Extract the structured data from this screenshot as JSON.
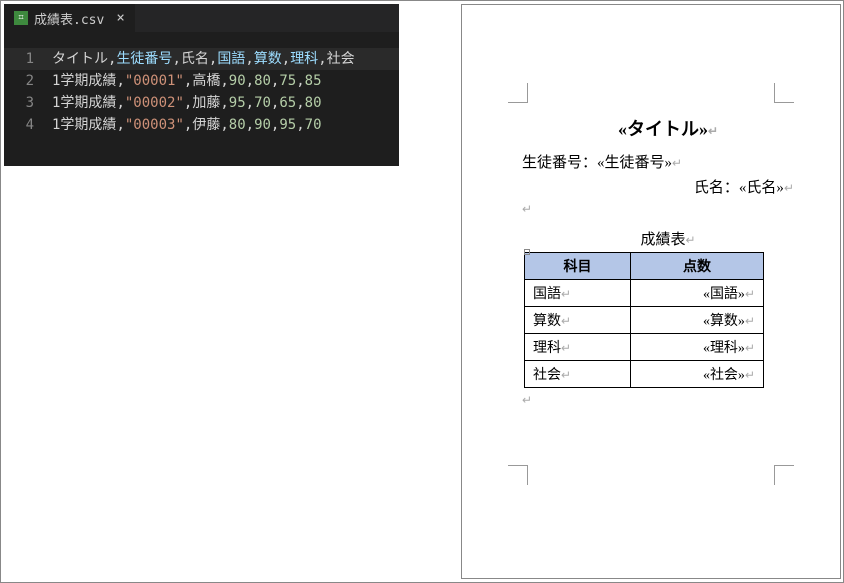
{
  "editor": {
    "filename": "成績表.csv",
    "lines": [
      {
        "n": "1",
        "tokens": [
          {
            "t": "タイトル",
            "c": "tok-plain"
          },
          {
            "t": ",",
            "c": "tok-plain"
          },
          {
            "t": "生徒番号",
            "c": "tok-field"
          },
          {
            "t": ",",
            "c": "tok-plain"
          },
          {
            "t": "氏名",
            "c": "tok-plain"
          },
          {
            "t": ",",
            "c": "tok-plain"
          },
          {
            "t": "国語",
            "c": "tok-field"
          },
          {
            "t": ",",
            "c": "tok-plain"
          },
          {
            "t": "算数",
            "c": "tok-field"
          },
          {
            "t": ",",
            "c": "tok-plain"
          },
          {
            "t": "理科",
            "c": "tok-field"
          },
          {
            "t": ",",
            "c": "tok-plain"
          },
          {
            "t": "社会",
            "c": "tok-plain"
          }
        ]
      },
      {
        "n": "2",
        "tokens": [
          {
            "t": "1学期成績",
            "c": "tok-plain"
          },
          {
            "t": ",",
            "c": "tok-plain"
          },
          {
            "t": "\"00001\"",
            "c": "tok-string"
          },
          {
            "t": ",",
            "c": "tok-plain"
          },
          {
            "t": "高橋",
            "c": "tok-plain"
          },
          {
            "t": ",",
            "c": "tok-plain"
          },
          {
            "t": "90",
            "c": "tok-number"
          },
          {
            "t": ",",
            "c": "tok-plain"
          },
          {
            "t": "80",
            "c": "tok-number"
          },
          {
            "t": ",",
            "c": "tok-plain"
          },
          {
            "t": "75",
            "c": "tok-number"
          },
          {
            "t": ",",
            "c": "tok-plain"
          },
          {
            "t": "85",
            "c": "tok-number"
          }
        ]
      },
      {
        "n": "3",
        "tokens": [
          {
            "t": "1学期成績",
            "c": "tok-plain"
          },
          {
            "t": ",",
            "c": "tok-plain"
          },
          {
            "t": "\"00002\"",
            "c": "tok-string"
          },
          {
            "t": ",",
            "c": "tok-plain"
          },
          {
            "t": "加藤",
            "c": "tok-plain"
          },
          {
            "t": ",",
            "c": "tok-plain"
          },
          {
            "t": "95",
            "c": "tok-number"
          },
          {
            "t": ",",
            "c": "tok-plain"
          },
          {
            "t": "70",
            "c": "tok-number"
          },
          {
            "t": ",",
            "c": "tok-plain"
          },
          {
            "t": "65",
            "c": "tok-number"
          },
          {
            "t": ",",
            "c": "tok-plain"
          },
          {
            "t": "80",
            "c": "tok-number"
          }
        ]
      },
      {
        "n": "4",
        "tokens": [
          {
            "t": "1学期成績",
            "c": "tok-plain"
          },
          {
            "t": ",",
            "c": "tok-plain"
          },
          {
            "t": "\"00003\"",
            "c": "tok-string"
          },
          {
            "t": ",",
            "c": "tok-plain"
          },
          {
            "t": "伊藤",
            "c": "tok-plain"
          },
          {
            "t": ",",
            "c": "tok-plain"
          },
          {
            "t": "80",
            "c": "tok-number"
          },
          {
            "t": ",",
            "c": "tok-plain"
          },
          {
            "t": "90",
            "c": "tok-number"
          },
          {
            "t": ",",
            "c": "tok-plain"
          },
          {
            "t": "95",
            "c": "tok-number"
          },
          {
            "t": ",",
            "c": "tok-plain"
          },
          {
            "t": "70",
            "c": "tok-number"
          }
        ]
      }
    ]
  },
  "doc": {
    "title_field": "«タイトル»",
    "student_no_label": "生徒番号：",
    "student_no_field": "«生徒番号»",
    "name_label": "氏名：",
    "name_field": "«氏名»",
    "table_caption": "成績表",
    "col_subject": "科目",
    "col_score": "点数",
    "rows": [
      {
        "subject": "国語",
        "score_field": "«国語»"
      },
      {
        "subject": "算数",
        "score_field": "«算数»"
      },
      {
        "subject": "理科",
        "score_field": "«理科»"
      },
      {
        "subject": "社会",
        "score_field": "«社会»"
      }
    ]
  },
  "chart_data": {
    "type": "table",
    "columns": [
      "タイトル",
      "生徒番号",
      "氏名",
      "国語",
      "算数",
      "理科",
      "社会"
    ],
    "rows": [
      [
        "1学期成績",
        "00001",
        "高橋",
        90,
        80,
        75,
        85
      ],
      [
        "1学期成績",
        "00002",
        "加藤",
        95,
        70,
        65,
        80
      ],
      [
        "1学期成績",
        "00003",
        "伊藤",
        80,
        90,
        95,
        70
      ]
    ]
  }
}
